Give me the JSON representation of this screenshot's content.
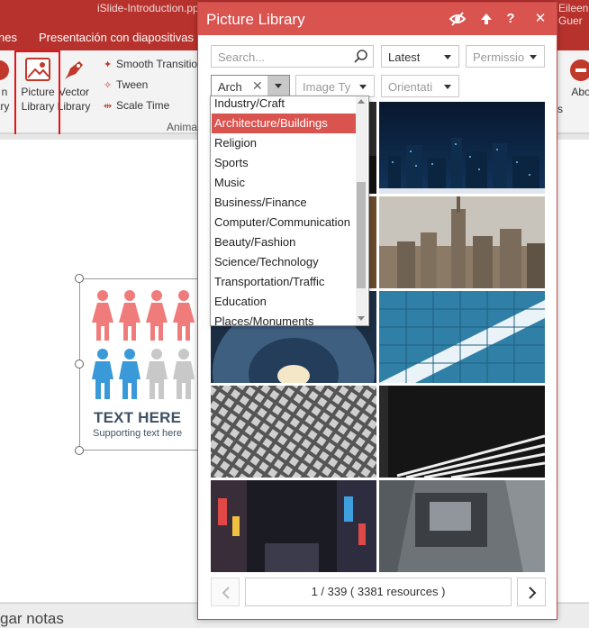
{
  "app": {
    "window_title": "iSlide-Introduction.ppt",
    "user_name": "Eileen Guer"
  },
  "ribbon": {
    "tabs": [
      "nes",
      "Presentación con diapositivas"
    ],
    "buttons": {
      "left_cut": [
        "n",
        "ary"
      ],
      "picture_library": [
        "Picture",
        "Library"
      ],
      "vector_library": [
        "Vector",
        "Library"
      ],
      "right_cut": "Abo"
    },
    "mini": [
      "Smooth Transitio",
      "Tween",
      "Scale Time"
    ],
    "group_label": "Animat",
    "stray": "s"
  },
  "slide": {
    "text_here": "TEXT HERE",
    "supporting_text": "Supporting text here"
  },
  "notes": {
    "label": "gar notas"
  },
  "panel": {
    "title": "Picture Library",
    "search_placeholder": "Search...",
    "sort": "Latest",
    "permission": "Permissio",
    "category_value": "Arch",
    "image_type": "Image Ty",
    "orientation": "Orientati",
    "dropdown": [
      "Industry/Craft",
      "Architecture/Buildings",
      "Religion",
      "Sports",
      "Music",
      "Business/Finance",
      "Computer/Communication",
      "Beauty/Fashion",
      "Science/Technology",
      "Transportation/Traffic",
      "Education",
      "Places/Monuments"
    ],
    "selected_index": 1,
    "pager_text": "1 / 339 ( 3381 resources )"
  },
  "colors": {
    "accent": "#d9534f",
    "ribbon_red": "#b7322c",
    "highlight_border": "#e2141a",
    "female": "#f07b7b",
    "male": "#3a9ad9",
    "grey_person": "#c8c8c8"
  }
}
